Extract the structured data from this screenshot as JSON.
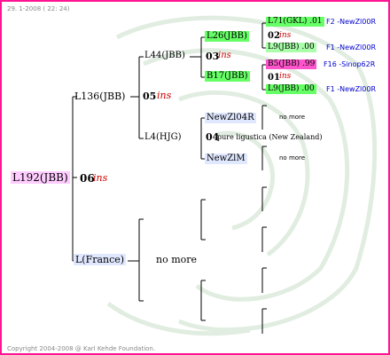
{
  "header": {
    "date_text": "29. 1-2008 ( 22: 24)"
  },
  "footer": {
    "copyright": "Copyright 2004-2008 @ Karl Kehde Foundation."
  },
  "colors": {
    "border": "#ff1493",
    "lines": "#000000",
    "ins": "#cc0000",
    "link": "#0000cc",
    "pink_box": "#ffccff",
    "green_box": "#66ff66",
    "magenta_box": "#ff55cc"
  },
  "tree": {
    "root": {
      "name": "L192(JBB)",
      "year": "06",
      "tag": "ins"
    },
    "sire": {
      "name": "L136(JBB)",
      "year": "05",
      "tag": "ins"
    },
    "dam": {
      "name": "L(France)",
      "note": "no more"
    },
    "ss": {
      "name": "L44(JBB)",
      "year": "03",
      "tag": "ins"
    },
    "sd": {
      "name": "L4(HJG)",
      "year": "04",
      "note": "pure ligustica (New Zealand)"
    },
    "sss": {
      "name": "L26(JBB)",
      "year": "02",
      "tag": "ins"
    },
    "ssd": {
      "name": "B17(JBB)",
      "year": "01",
      "tag": "ins"
    },
    "sds": {
      "name": "NewZl04R",
      "note": "no more"
    },
    "sdd": {
      "name": "NewZlM",
      "note": "no more"
    },
    "g1": {
      "name": "L71(GKL) .01",
      "origin": "F2 -NewZl00R"
    },
    "g2": {
      "name": "L9(JBB) .00",
      "origin": "F1 -NewZl00R"
    },
    "g3": {
      "name": "B5(JBB) .99",
      "origin": "F16 -Sinop62R"
    },
    "g4": {
      "name": "L9(JBB) .00",
      "origin": "F1 -NewZl00R"
    }
  }
}
